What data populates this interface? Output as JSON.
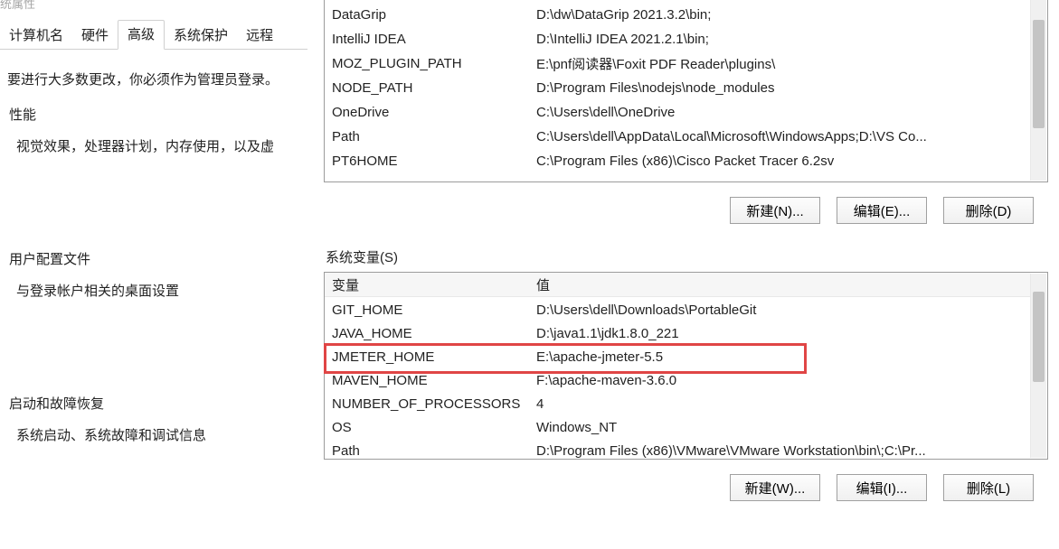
{
  "left": {
    "title_disabled": "统属性",
    "tabs": [
      "计算机名",
      "硬件",
      "高级",
      "系统保护",
      "远程"
    ],
    "active_tab": 2,
    "admin_note": "要进行大多数更改，你必须作为管理员登录。",
    "group_performance": {
      "label": "性能",
      "desc": "视觉效果，处理器计划，内存使用，以及虚"
    },
    "group_profiles": {
      "label": "用户配置文件",
      "desc": "与登录帐户相关的桌面设置"
    },
    "group_startup": {
      "label": "启动和故障恢复",
      "desc": "系统启动、系统故障和调试信息"
    }
  },
  "user_vars": {
    "rows": [
      {
        "var": "DataGrip",
        "val": "D:\\dw\\DataGrip 2021.3.2\\bin;"
      },
      {
        "var": "IntelliJ IDEA",
        "val": "D:\\IntelliJ IDEA 2021.2.1\\bin;"
      },
      {
        "var": "MOZ_PLUGIN_PATH",
        "val": "E:\\pnf阅读器\\Foxit PDF Reader\\plugins\\"
      },
      {
        "var": "NODE_PATH",
        "val": "D:\\Program Files\\nodejs\\node_modules"
      },
      {
        "var": "OneDrive",
        "val": "C:\\Users\\dell\\OneDrive"
      },
      {
        "var": "Path",
        "val": "C:\\Users\\dell\\AppData\\Local\\Microsoft\\WindowsApps;D:\\VS Co..."
      },
      {
        "var": "PT6HOME",
        "val": "C:\\Program Files (x86)\\Cisco Packet Tracer 6.2sv"
      }
    ],
    "buttons": {
      "new": "新建(N)...",
      "edit": "编辑(E)...",
      "delete": "删除(D)"
    }
  },
  "sys_section_label": "系统变量(S)",
  "sys_vars": {
    "header": {
      "var": "变量",
      "val": "值"
    },
    "rows": [
      {
        "var": "GIT_HOME",
        "val": "D:\\Users\\dell\\Downloads\\PortableGit"
      },
      {
        "var": "JAVA_HOME",
        "val": "D:\\java1.1\\jdk1.8.0_221"
      },
      {
        "var": "JMETER_HOME",
        "val": "E:\\apache-jmeter-5.5"
      },
      {
        "var": "MAVEN_HOME",
        "val": "F:\\apache-maven-3.6.0"
      },
      {
        "var": "NUMBER_OF_PROCESSORS",
        "val": "4"
      },
      {
        "var": "OS",
        "val": "Windows_NT"
      },
      {
        "var": "Path",
        "val": "D:\\Program Files (x86)\\VMware\\VMware Workstation\\bin\\;C:\\Pr..."
      }
    ],
    "buttons": {
      "new": "新建(W)...",
      "edit": "编辑(I)...",
      "delete": "删除(L)"
    }
  }
}
